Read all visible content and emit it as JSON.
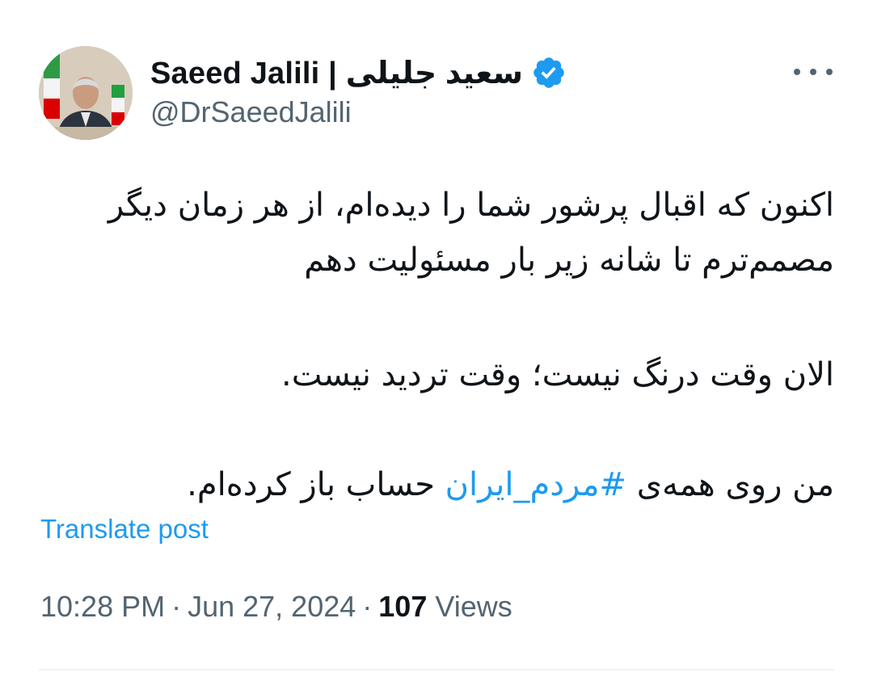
{
  "author": {
    "display_name": "Saeed Jalili | سعید جلیلی",
    "handle": "@DrSaeedJalili",
    "verified_icon": "verified-badge-icon"
  },
  "menu": {
    "icon": "more-horizontal-icon"
  },
  "tweet": {
    "paragraph_1": "اکنون که اقبال پرشور شما را دیده‌ام، از هر زمان دیگر مصمم‌ترم تا شانه زیر بار مسئولیت دهم",
    "paragraph_2": "الان وقت درنگ نیست؛ وقت تردید نیست.",
    "paragraph_3_before": "من روی همه‌ی ",
    "paragraph_3_hashtag": "#مردم_ایران",
    "paragraph_3_after": " حساب باز کرده‌ام."
  },
  "translate_label": "Translate post",
  "meta": {
    "time": "10:28 PM",
    "separator": "·",
    "date": "Jun 27, 2024",
    "views_count": "107",
    "views_label": "Views"
  },
  "colors": {
    "accent": "#1d9bf0",
    "text_primary": "#0f1419",
    "text_secondary": "#536471"
  }
}
